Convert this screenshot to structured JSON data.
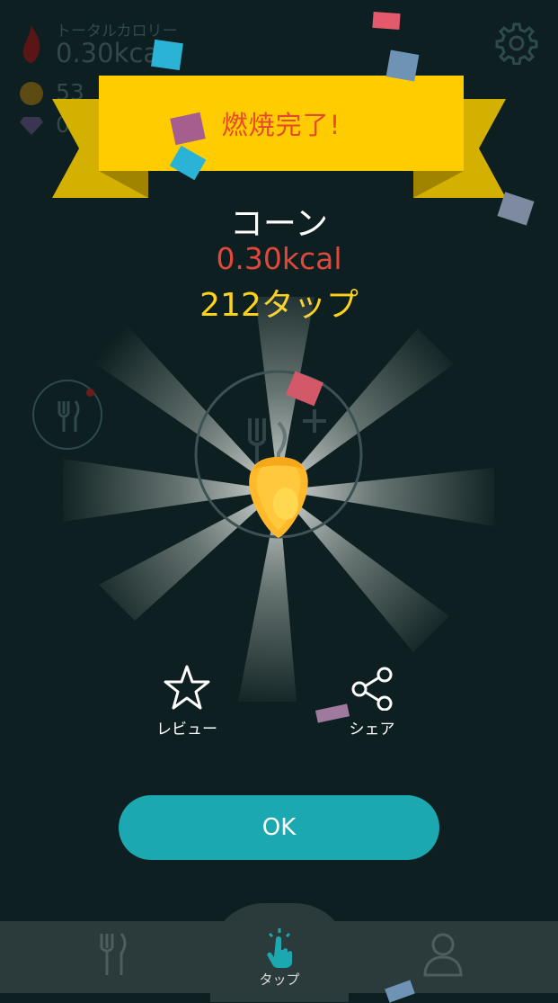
{
  "header": {
    "total_label": "トータルカロリー",
    "total_kcal": "0.30kcal",
    "coins": "53",
    "gems": "0"
  },
  "banner": {
    "text": "燃焼完了!"
  },
  "result": {
    "food_name": "コーン",
    "kcal": "0.30kcal",
    "taps": "212タップ"
  },
  "actions": {
    "review_label": "レビュー",
    "share_label": "シェア"
  },
  "ok_label": "OK",
  "nav": {
    "food_icon": "fork-knife-icon",
    "tap_label": "タップ",
    "tap_icon": "tap-hand-icon",
    "profile_icon": "user-icon"
  },
  "colors": {
    "background": "#0d1f20",
    "banner": "#ffcc00",
    "banner_shadow": "#d4b000",
    "banner_text": "#e44a2b",
    "kcal": "#e0493a",
    "taps": "#ffd21a",
    "ok_button": "#1ba8b0",
    "navbar": "#2b3b3c"
  }
}
